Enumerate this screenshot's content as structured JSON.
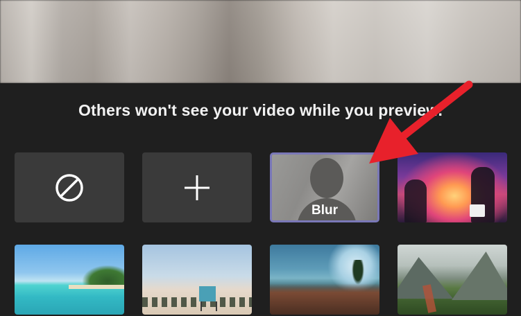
{
  "notice": {
    "text": "Others won't see your video while you preview."
  },
  "effects": {
    "none_option": {
      "icon": "no-effect-icon"
    },
    "add_option": {
      "icon": "plus-icon"
    },
    "blur_option": {
      "label": "Blur",
      "selected": true,
      "border_color": "#7a78b8"
    },
    "backgrounds": [
      {
        "name": "sunset-artwork"
      },
      {
        "name": "tropical-beach"
      },
      {
        "name": "lifeguard-tower-beach"
      },
      {
        "name": "fantasy-landscape"
      },
      {
        "name": "mountain-valley"
      }
    ]
  },
  "annotation": {
    "arrow_color": "#e8212b",
    "points_to": "blur_option"
  },
  "colors": {
    "panel_background": "#1f1f1f",
    "tile_gray": "#3a3a3a",
    "text": "#f2f2f2"
  }
}
